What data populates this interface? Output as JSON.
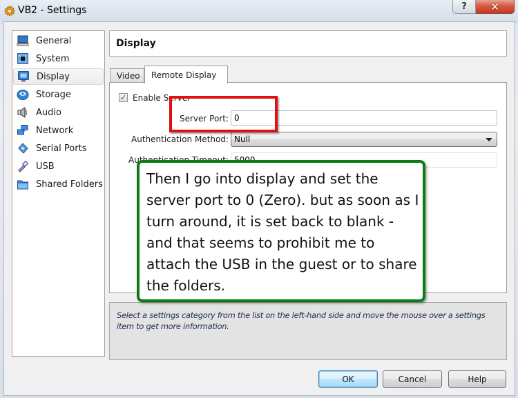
{
  "window": {
    "title": "VB2 - Settings",
    "app_icon": "gear-icon",
    "help_button_glyph": "?",
    "close_button_glyph": "✕"
  },
  "sidebar": {
    "items": [
      {
        "label": "General",
        "icon": "monitor-icon",
        "selected": false
      },
      {
        "label": "System",
        "icon": "chip-icon",
        "selected": false
      },
      {
        "label": "Display",
        "icon": "display-icon",
        "selected": true
      },
      {
        "label": "Storage",
        "icon": "disk-icon",
        "selected": false
      },
      {
        "label": "Audio",
        "icon": "speaker-icon",
        "selected": false
      },
      {
        "label": "Network",
        "icon": "network-icon",
        "selected": false
      },
      {
        "label": "Serial Ports",
        "icon": "serial-port-icon",
        "selected": false
      },
      {
        "label": "USB",
        "icon": "usb-icon",
        "selected": false
      },
      {
        "label": "Shared Folders",
        "icon": "folder-icon",
        "selected": false
      }
    ]
  },
  "page": {
    "title": "Display",
    "tabs": [
      {
        "label": "Video",
        "active": false
      },
      {
        "label": "Remote Display",
        "active": true
      }
    ]
  },
  "remote_display": {
    "enable_server_label": "Enable Server",
    "enable_server_checked": true,
    "check_glyph": "✓",
    "server_port_label": "Server Port:",
    "server_port_value": "0",
    "auth_method_label": "Authentication Method:",
    "auth_method_value": "Null",
    "auth_timeout_label": "Authentication Timeout:",
    "auth_timeout_value": "5000"
  },
  "info": {
    "text": "Select a settings category from the list on the left-hand side and move the mouse over a settings item to get more information."
  },
  "buttons": {
    "ok": "OK",
    "cancel": "Cancel",
    "help": "Help"
  },
  "annotation": {
    "callout_text": "Then I go into display and set the server port to 0 (Zero). but as soon as I turn around, it is set back to blank - and that seems to prohibit me to attach the USB in the guest or to share the folders.",
    "highlight_color": "#e01010",
    "callout_border_color": "#0a7d12"
  }
}
